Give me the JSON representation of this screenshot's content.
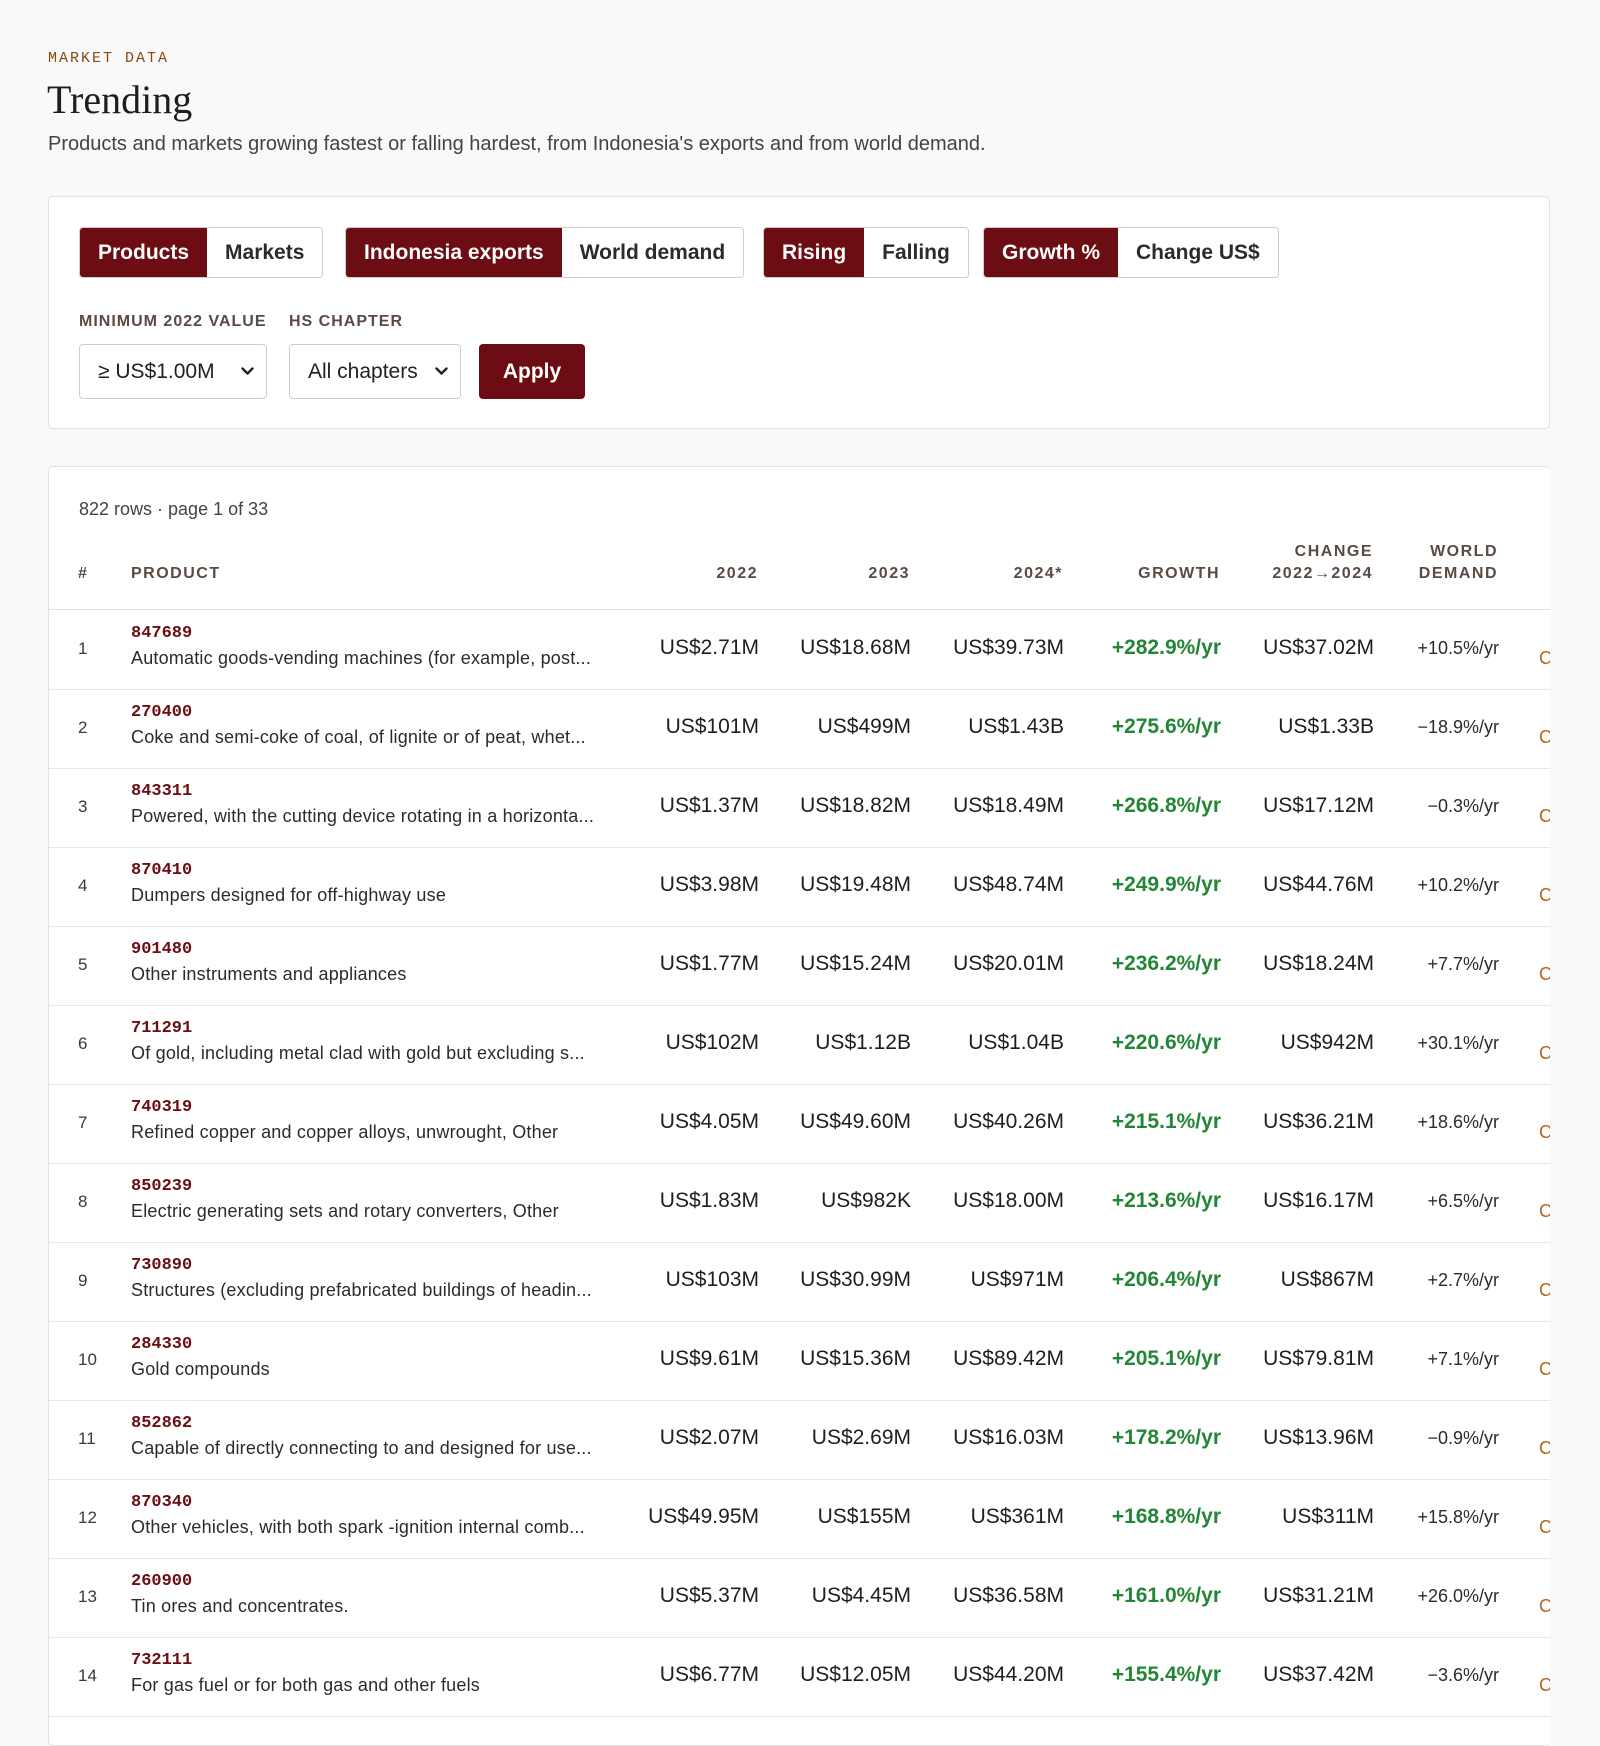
{
  "header": {
    "eyebrow": "MARKET DATA",
    "title": "Trending",
    "subtitle": "Products and markets growing fastest or falling hardest, from Indonesia's exports and from world demand."
  },
  "filters": {
    "toggles": [
      {
        "options": [
          "Products",
          "Markets"
        ],
        "active": 0
      },
      {
        "options": [
          "Indonesia exports",
          "World demand"
        ],
        "active": 0
      },
      {
        "options": [
          "Rising",
          "Falling"
        ],
        "active": 0
      },
      {
        "options": [
          "Growth %",
          "Change US$"
        ],
        "active": 0
      }
    ],
    "min_value_label": "MINIMUM 2022 VALUE",
    "min_value_selected": "≥ US$1.00M",
    "hs_chapter_label": "HS CHAPTER",
    "hs_chapter_selected": "All chapters",
    "apply_label": "Apply"
  },
  "table": {
    "meta": "822 rows · page 1 of 33",
    "columns": {
      "rank": "#",
      "product": "PRODUCT",
      "y2022": "2022",
      "y2023": "2023",
      "y2024": "2024*",
      "growth": "GROWTH",
      "change_l1": "CHANGE",
      "change_l2": "2022→2024",
      "world_l1": "WORLD",
      "world_l2": "DEMAND"
    },
    "more_glyph": "C",
    "rows": [
      {
        "rank": "1",
        "code": "847689",
        "name": "Automatic goods-vending machines (for example, post...",
        "v2022": "US$2.71M",
        "v2023": "US$18.68M",
        "v2024": "US$39.73M",
        "growth": "+282.9%/yr",
        "change": "US$37.02M",
        "world": "+10.5%/yr"
      },
      {
        "rank": "2",
        "code": "270400",
        "name": "Coke and semi-coke of coal, of lignite or of peat, whet...",
        "v2022": "US$101M",
        "v2023": "US$499M",
        "v2024": "US$1.43B",
        "growth": "+275.6%/yr",
        "change": "US$1.33B",
        "world": "−18.9%/yr"
      },
      {
        "rank": "3",
        "code": "843311",
        "name": "Powered, with the cutting device rotating in a horizonta...",
        "v2022": "US$1.37M",
        "v2023": "US$18.82M",
        "v2024": "US$18.49M",
        "growth": "+266.8%/yr",
        "change": "US$17.12M",
        "world": "−0.3%/yr"
      },
      {
        "rank": "4",
        "code": "870410",
        "name": "Dumpers designed for off-highway use",
        "v2022": "US$3.98M",
        "v2023": "US$19.48M",
        "v2024": "US$48.74M",
        "growth": "+249.9%/yr",
        "change": "US$44.76M",
        "world": "+10.2%/yr"
      },
      {
        "rank": "5",
        "code": "901480",
        "name": "Other instruments and appliances",
        "v2022": "US$1.77M",
        "v2023": "US$15.24M",
        "v2024": "US$20.01M",
        "growth": "+236.2%/yr",
        "change": "US$18.24M",
        "world": "+7.7%/yr"
      },
      {
        "rank": "6",
        "code": "711291",
        "name": "Of gold, including metal clad with gold but excluding s...",
        "v2022": "US$102M",
        "v2023": "US$1.12B",
        "v2024": "US$1.04B",
        "growth": "+220.6%/yr",
        "change": "US$942M",
        "world": "+30.1%/yr"
      },
      {
        "rank": "7",
        "code": "740319",
        "name": "Refined copper and copper alloys, unwrought, Other",
        "v2022": "US$4.05M",
        "v2023": "US$49.60M",
        "v2024": "US$40.26M",
        "growth": "+215.1%/yr",
        "change": "US$36.21M",
        "world": "+18.6%/yr"
      },
      {
        "rank": "8",
        "code": "850239",
        "name": "Electric generating sets and rotary converters, Other",
        "v2022": "US$1.83M",
        "v2023": "US$982K",
        "v2024": "US$18.00M",
        "growth": "+213.6%/yr",
        "change": "US$16.17M",
        "world": "+6.5%/yr"
      },
      {
        "rank": "9",
        "code": "730890",
        "name": "Structures (excluding prefabricated buildings of headin...",
        "v2022": "US$103M",
        "v2023": "US$30.99M",
        "v2024": "US$971M",
        "growth": "+206.4%/yr",
        "change": "US$867M",
        "world": "+2.7%/yr"
      },
      {
        "rank": "10",
        "code": "284330",
        "name": "Gold compounds",
        "v2022": "US$9.61M",
        "v2023": "US$15.36M",
        "v2024": "US$89.42M",
        "growth": "+205.1%/yr",
        "change": "US$79.81M",
        "world": "+7.1%/yr"
      },
      {
        "rank": "11",
        "code": "852862",
        "name": "Capable of directly connecting to and designed for use...",
        "v2022": "US$2.07M",
        "v2023": "US$2.69M",
        "v2024": "US$16.03M",
        "growth": "+178.2%/yr",
        "change": "US$13.96M",
        "world": "−0.9%/yr"
      },
      {
        "rank": "12",
        "code": "870340",
        "name": "Other vehicles, with both spark -ignition internal comb...",
        "v2022": "US$49.95M",
        "v2023": "US$155M",
        "v2024": "US$361M",
        "growth": "+168.8%/yr",
        "change": "US$311M",
        "world": "+15.8%/yr"
      },
      {
        "rank": "13",
        "code": "260900",
        "name": "Tin ores and concentrates.",
        "v2022": "US$5.37M",
        "v2023": "US$4.45M",
        "v2024": "US$36.58M",
        "growth": "+161.0%/yr",
        "change": "US$31.21M",
        "world": "+26.0%/yr"
      },
      {
        "rank": "14",
        "code": "732111",
        "name": "For gas fuel or for both gas and other fuels",
        "v2022": "US$6.77M",
        "v2023": "US$12.05M",
        "v2024": "US$44.20M",
        "growth": "+155.4%/yr",
        "change": "US$37.42M",
        "world": "−3.6%/yr"
      }
    ]
  },
  "colors": {
    "accent": "#6b0d12",
    "growth_positive": "#238636",
    "eyebrow": "#8a4a12",
    "background": "#f9f9fa"
  },
  "icons": {
    "select_arrow": "chevron-down-icon"
  }
}
